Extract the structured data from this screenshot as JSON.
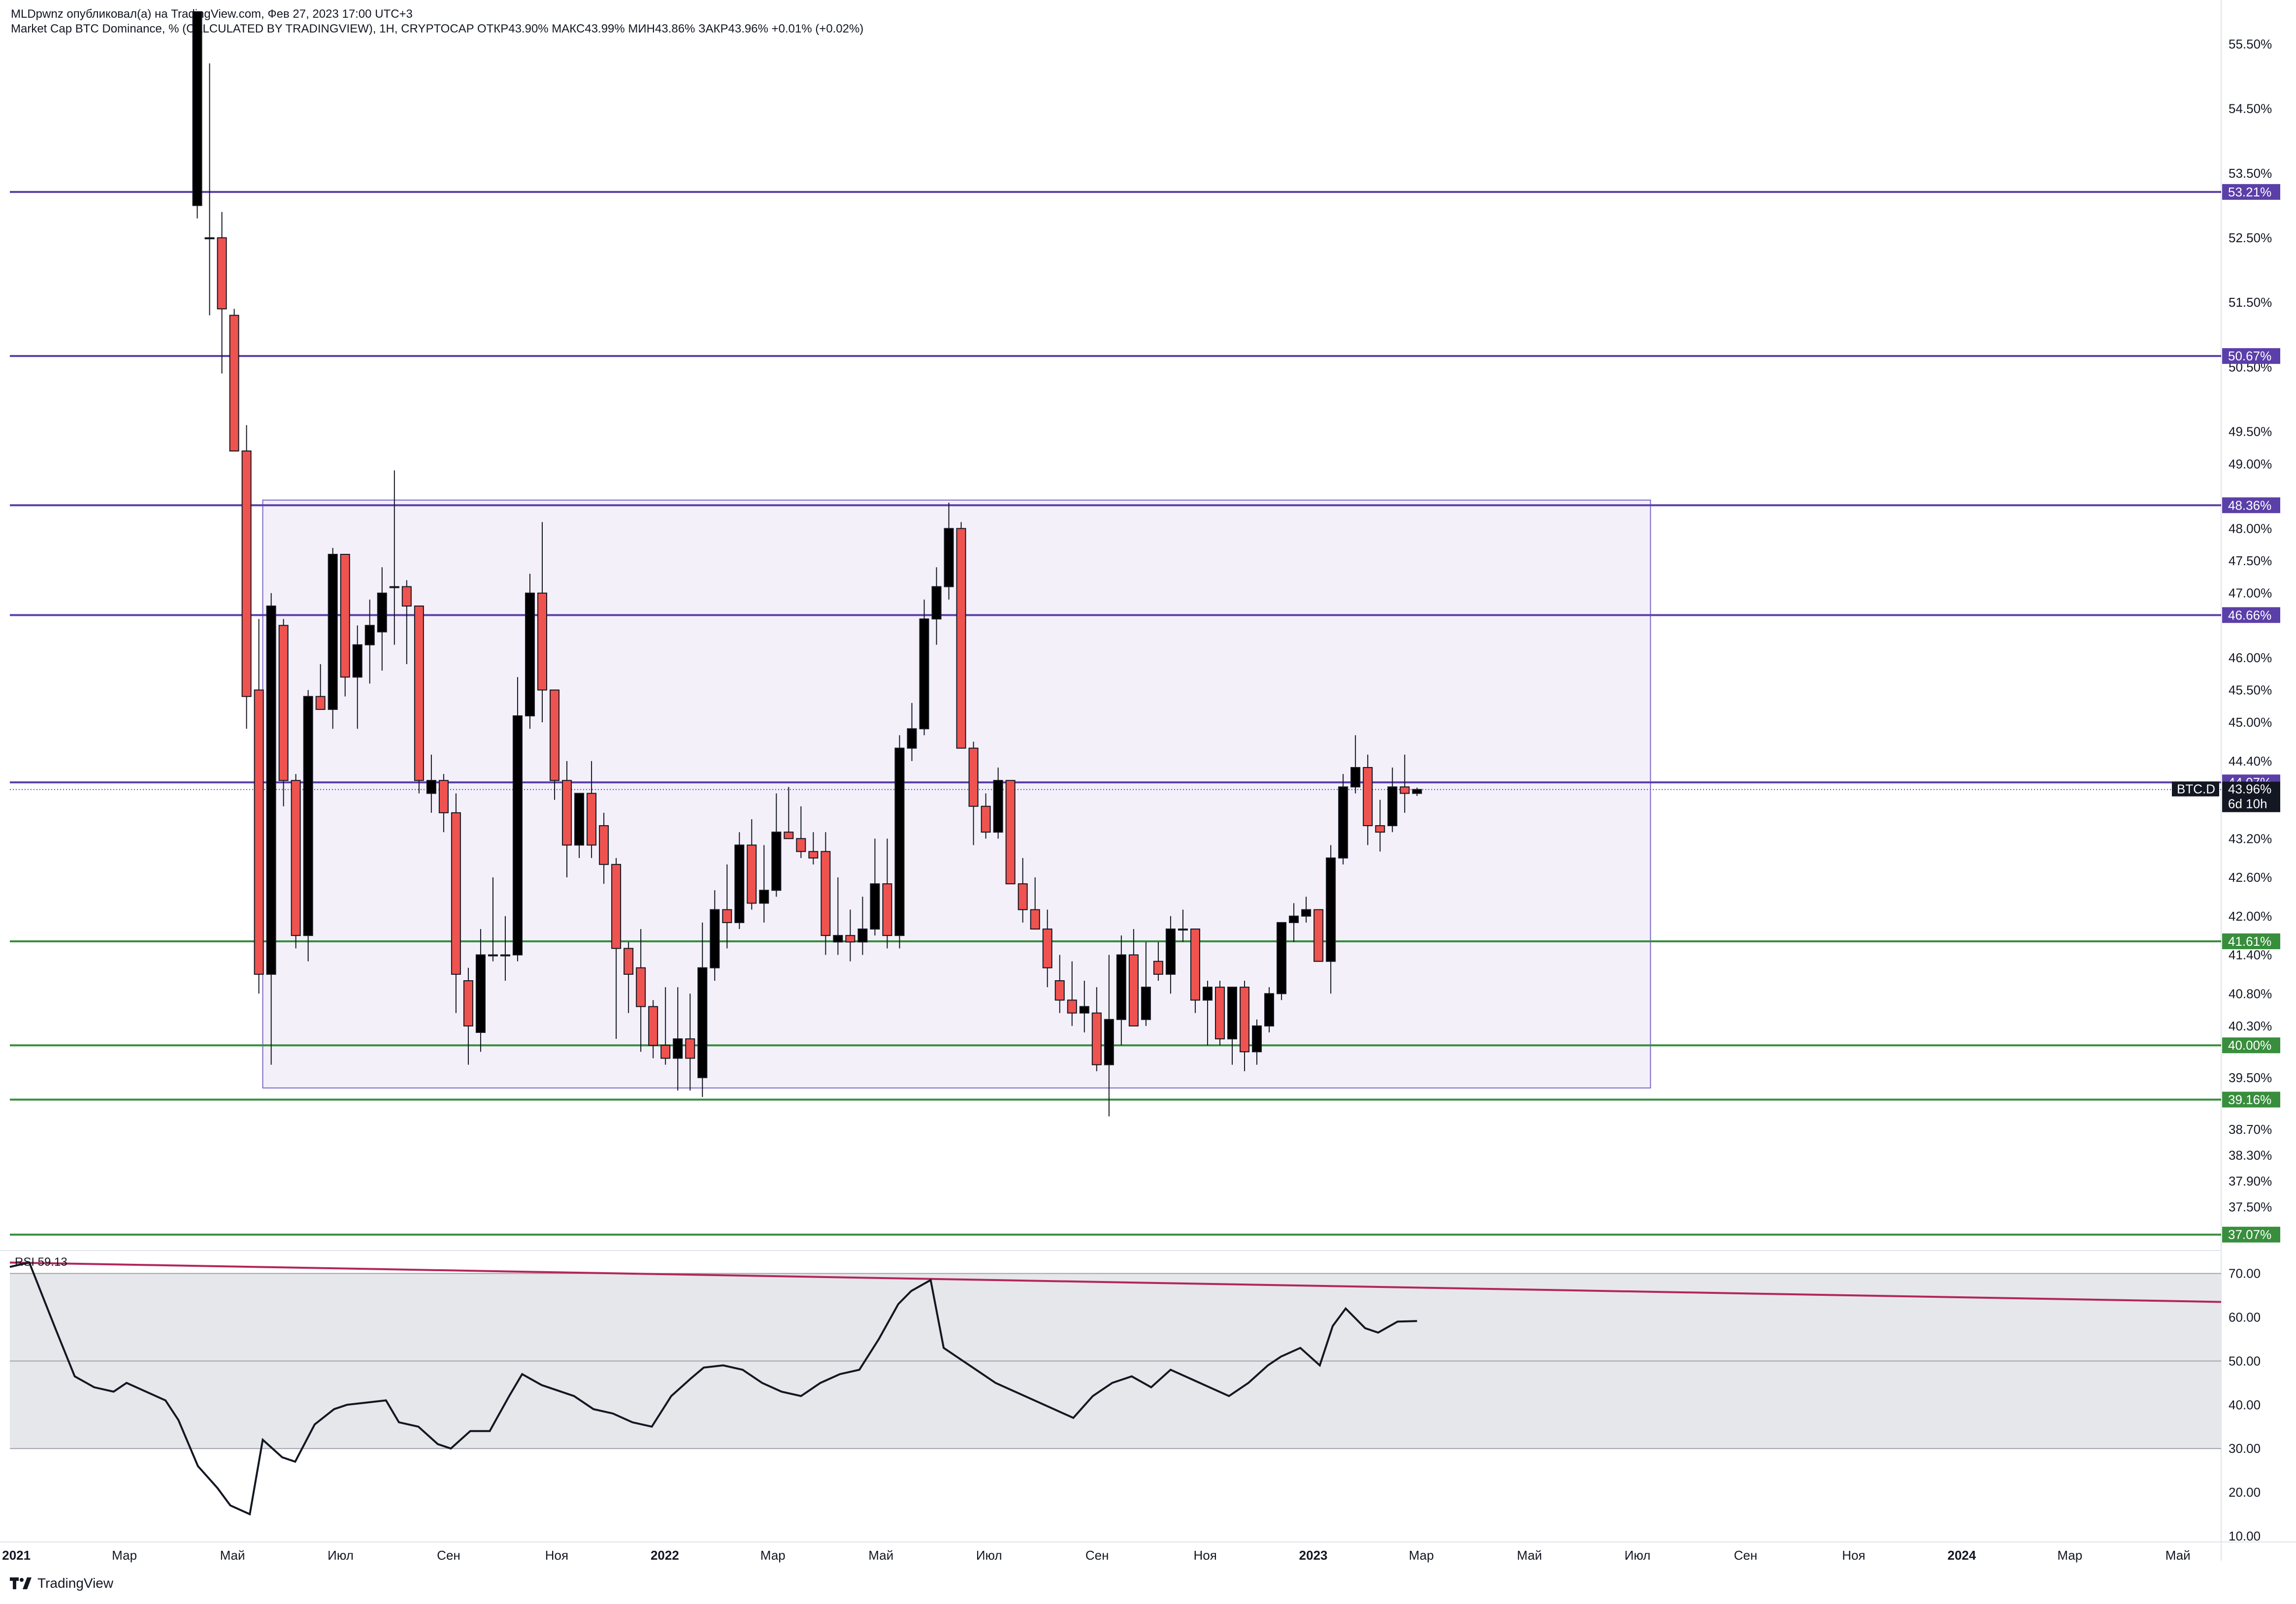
{
  "header": {
    "publisher_line": "MLDpwnz опубликовал(а) на TradingView.com, Фев 27, 2023 17:00 UTC+3",
    "symbol_line": "Market Cap BTC Dominance, % (CALCULATED BY TRADINGVIEW), 1H, CRYPTOCAP  ОТКР43.90%  МАКС43.99%  МИН43.86%  ЗАКР43.96%  +0.01% (+0.02%)"
  },
  "footer": {
    "logo_text": "TradingView"
  },
  "rsi_label": "RSI  59.13",
  "colors": {
    "bull": "#000000",
    "bear": "#ef5350",
    "purple": "#5b3fa8",
    "green": "#388e3c",
    "box_fill": "#f3f0fa",
    "box_border": "#7b68c8",
    "rsi_band": "#e6e7ea",
    "rsi_trend": "#b2275a"
  },
  "chart_data": [
    {
      "type": "candlestick",
      "title": "Market Cap BTC Dominance, % (CALCULATED BY TRADINGVIEW)",
      "y_axis_ticks": [
        "55.50%",
        "54.50%",
        "53.50%",
        "52.50%",
        "51.50%",
        "50.50%",
        "49.50%",
        "49.00%",
        "48.00%",
        "47.50%",
        "47.00%",
        "46.00%",
        "45.50%",
        "45.00%",
        "44.40%",
        "43.20%",
        "42.60%",
        "42.00%",
        "41.40%",
        "40.80%",
        "40.30%",
        "39.50%",
        "38.70%",
        "38.30%",
        "37.90%",
        "37.50%"
      ],
      "x_axis_ticks": [
        "2021",
        "Мар",
        "Май",
        "Июл",
        "Сен",
        "Ноя",
        "2022",
        "Мар",
        "Май",
        "Июл",
        "Сен",
        "Ноя",
        "2023",
        "Мар",
        "Май",
        "Июл",
        "Сен",
        "Ноя",
        "2024",
        "Мар",
        "Май"
      ],
      "ylim": [
        36.9,
        55.8
      ],
      "xlim": [
        2020.99,
        2024.4
      ],
      "candles": [
        {
          "t": 2021.279,
          "o": 53.0,
          "h": 56.0,
          "l": 52.8,
          "c": 56.0
        },
        {
          "t": 2021.298,
          "o": 52.5,
          "h": 55.2,
          "l": 51.3,
          "c": 52.5
        },
        {
          "t": 2021.317,
          "o": 52.5,
          "h": 52.9,
          "l": 50.4,
          "c": 51.4
        },
        {
          "t": 2021.336,
          "o": 51.3,
          "h": 51.4,
          "l": 49.2,
          "c": 49.2
        },
        {
          "t": 2021.355,
          "o": 49.2,
          "h": 49.6,
          "l": 44.9,
          "c": 45.4
        },
        {
          "t": 2021.374,
          "o": 45.5,
          "h": 46.6,
          "l": 40.8,
          "c": 41.1
        },
        {
          "t": 2021.393,
          "o": 41.1,
          "h": 47.0,
          "l": 39.7,
          "c": 46.8
        },
        {
          "t": 2021.412,
          "o": 46.5,
          "h": 46.6,
          "l": 43.7,
          "c": 44.1
        },
        {
          "t": 2021.431,
          "o": 44.1,
          "h": 44.2,
          "l": 41.5,
          "c": 41.7
        },
        {
          "t": 2021.45,
          "o": 41.7,
          "h": 45.5,
          "l": 41.3,
          "c": 45.4
        },
        {
          "t": 2021.469,
          "o": 45.4,
          "h": 45.9,
          "l": 45.2,
          "c": 45.2
        },
        {
          "t": 2021.488,
          "o": 45.2,
          "h": 47.7,
          "l": 44.9,
          "c": 47.6
        },
        {
          "t": 2021.507,
          "o": 47.6,
          "h": 47.6,
          "l": 45.4,
          "c": 45.7
        },
        {
          "t": 2021.526,
          "o": 45.7,
          "h": 46.5,
          "l": 44.9,
          "c": 46.2
        },
        {
          "t": 2021.545,
          "o": 46.2,
          "h": 46.9,
          "l": 45.6,
          "c": 46.5
        },
        {
          "t": 2021.564,
          "o": 46.4,
          "h": 47.4,
          "l": 45.8,
          "c": 47.0
        },
        {
          "t": 2021.583,
          "o": 47.1,
          "h": 48.9,
          "l": 46.2,
          "c": 47.1
        },
        {
          "t": 2021.602,
          "o": 47.1,
          "h": 47.2,
          "l": 45.9,
          "c": 46.8
        },
        {
          "t": 2021.621,
          "o": 46.8,
          "h": 46.8,
          "l": 43.9,
          "c": 44.1
        },
        {
          "t": 2021.64,
          "o": 43.9,
          "h": 44.5,
          "l": 43.6,
          "c": 44.1
        },
        {
          "t": 2021.659,
          "o": 44.1,
          "h": 44.2,
          "l": 43.3,
          "c": 43.6
        },
        {
          "t": 2021.678,
          "o": 43.6,
          "h": 43.9,
          "l": 40.5,
          "c": 41.1
        },
        {
          "t": 2021.697,
          "o": 41.0,
          "h": 41.2,
          "l": 39.7,
          "c": 40.3
        },
        {
          "t": 2021.716,
          "o": 40.2,
          "h": 41.8,
          "l": 39.9,
          "c": 41.4
        },
        {
          "t": 2021.735,
          "o": 41.4,
          "h": 42.6,
          "l": 41.3,
          "c": 41.4
        },
        {
          "t": 2021.754,
          "o": 41.4,
          "h": 42.0,
          "l": 41.0,
          "c": 41.4
        },
        {
          "t": 2021.773,
          "o": 41.4,
          "h": 45.7,
          "l": 41.3,
          "c": 45.1
        },
        {
          "t": 2021.792,
          "o": 45.1,
          "h": 47.3,
          "l": 44.9,
          "c": 47.0
        },
        {
          "t": 2021.811,
          "o": 47.0,
          "h": 48.1,
          "l": 45.0,
          "c": 45.5
        },
        {
          "t": 2021.83,
          "o": 45.5,
          "h": 45.5,
          "l": 43.8,
          "c": 44.1
        },
        {
          "t": 2021.849,
          "o": 44.1,
          "h": 44.4,
          "l": 42.6,
          "c": 43.1
        },
        {
          "t": 2021.868,
          "o": 43.1,
          "h": 43.9,
          "l": 42.9,
          "c": 43.9
        },
        {
          "t": 2021.887,
          "o": 43.9,
          "h": 44.4,
          "l": 42.9,
          "c": 43.1
        },
        {
          "t": 2021.906,
          "o": 43.4,
          "h": 43.6,
          "l": 42.5,
          "c": 42.8
        },
        {
          "t": 2021.925,
          "o": 42.8,
          "h": 42.9,
          "l": 40.1,
          "c": 41.5
        },
        {
          "t": 2021.944,
          "o": 41.5,
          "h": 41.6,
          "l": 40.5,
          "c": 41.1
        },
        {
          "t": 2021.963,
          "o": 41.2,
          "h": 41.8,
          "l": 39.9,
          "c": 40.6
        },
        {
          "t": 2021.982,
          "o": 40.6,
          "h": 40.7,
          "l": 39.8,
          "c": 40.0
        },
        {
          "t": 2022.001,
          "o": 40.0,
          "h": 40.9,
          "l": 39.7,
          "c": 39.8
        },
        {
          "t": 2022.02,
          "o": 39.8,
          "h": 40.9,
          "l": 39.3,
          "c": 40.1
        },
        {
          "t": 2022.039,
          "o": 40.1,
          "h": 40.8,
          "l": 39.3,
          "c": 39.8
        },
        {
          "t": 2022.058,
          "o": 39.5,
          "h": 41.9,
          "l": 39.2,
          "c": 41.2
        },
        {
          "t": 2022.077,
          "o": 41.2,
          "h": 42.4,
          "l": 41.0,
          "c": 42.1
        },
        {
          "t": 2022.096,
          "o": 42.1,
          "h": 42.8,
          "l": 41.5,
          "c": 41.9
        },
        {
          "t": 2022.115,
          "o": 41.9,
          "h": 43.3,
          "l": 41.8,
          "c": 43.1
        },
        {
          "t": 2022.134,
          "o": 43.1,
          "h": 43.5,
          "l": 42.1,
          "c": 42.2
        },
        {
          "t": 2022.153,
          "o": 42.2,
          "h": 43.1,
          "l": 41.9,
          "c": 42.4
        },
        {
          "t": 2022.172,
          "o": 42.4,
          "h": 43.9,
          "l": 42.3,
          "c": 43.3
        },
        {
          "t": 2022.191,
          "o": 43.3,
          "h": 44.0,
          "l": 43.2,
          "c": 43.2
        },
        {
          "t": 2022.21,
          "o": 43.2,
          "h": 43.7,
          "l": 42.9,
          "c": 43.0
        },
        {
          "t": 2022.229,
          "o": 43.0,
          "h": 43.3,
          "l": 42.8,
          "c": 42.9
        },
        {
          "t": 2022.248,
          "o": 43.0,
          "h": 43.3,
          "l": 41.4,
          "c": 41.7
        },
        {
          "t": 2022.267,
          "o": 41.6,
          "h": 42.6,
          "l": 41.4,
          "c": 41.7
        },
        {
          "t": 2022.286,
          "o": 41.7,
          "h": 42.1,
          "l": 41.3,
          "c": 41.6
        },
        {
          "t": 2022.305,
          "o": 41.6,
          "h": 42.3,
          "l": 41.4,
          "c": 41.8
        },
        {
          "t": 2022.324,
          "o": 41.8,
          "h": 43.2,
          "l": 41.7,
          "c": 42.5
        },
        {
          "t": 2022.343,
          "o": 42.5,
          "h": 43.2,
          "l": 41.5,
          "c": 41.7
        },
        {
          "t": 2022.362,
          "o": 41.7,
          "h": 44.8,
          "l": 41.5,
          "c": 44.6
        },
        {
          "t": 2022.381,
          "o": 44.6,
          "h": 45.3,
          "l": 44.4,
          "c": 44.9
        },
        {
          "t": 2022.4,
          "o": 44.9,
          "h": 46.9,
          "l": 44.8,
          "c": 46.6
        },
        {
          "t": 2022.419,
          "o": 46.6,
          "h": 47.4,
          "l": 46.2,
          "c": 47.1
        },
        {
          "t": 2022.438,
          "o": 47.1,
          "h": 48.4,
          "l": 46.9,
          "c": 48.0
        },
        {
          "t": 2022.457,
          "o": 48.0,
          "h": 48.1,
          "l": 44.6,
          "c": 44.6
        },
        {
          "t": 2022.476,
          "o": 44.6,
          "h": 44.7,
          "l": 43.1,
          "c": 43.7
        },
        {
          "t": 2022.495,
          "o": 43.7,
          "h": 43.9,
          "l": 43.2,
          "c": 43.3
        },
        {
          "t": 2022.514,
          "o": 43.3,
          "h": 44.3,
          "l": 43.2,
          "c": 44.1
        },
        {
          "t": 2022.533,
          "o": 44.1,
          "h": 44.1,
          "l": 42.5,
          "c": 42.5
        },
        {
          "t": 2022.552,
          "o": 42.5,
          "h": 42.9,
          "l": 41.9,
          "c": 42.1
        },
        {
          "t": 2022.571,
          "o": 42.1,
          "h": 42.6,
          "l": 41.8,
          "c": 41.8
        },
        {
          "t": 2022.59,
          "o": 41.8,
          "h": 42.1,
          "l": 40.9,
          "c": 41.2
        },
        {
          "t": 2022.609,
          "o": 41.0,
          "h": 41.4,
          "l": 40.5,
          "c": 40.7
        },
        {
          "t": 2022.628,
          "o": 40.7,
          "h": 41.3,
          "l": 40.3,
          "c": 40.5
        },
        {
          "t": 2022.647,
          "o": 40.5,
          "h": 41.0,
          "l": 40.2,
          "c": 40.6
        },
        {
          "t": 2022.666,
          "o": 40.5,
          "h": 40.9,
          "l": 39.6,
          "c": 39.7
        },
        {
          "t": 2022.685,
          "o": 39.7,
          "h": 41.4,
          "l": 38.9,
          "c": 40.4
        },
        {
          "t": 2022.704,
          "o": 40.4,
          "h": 41.7,
          "l": 40.0,
          "c": 41.4
        },
        {
          "t": 2022.723,
          "o": 41.4,
          "h": 41.8,
          "l": 40.6,
          "c": 40.3
        },
        {
          "t": 2022.742,
          "o": 40.4,
          "h": 41.6,
          "l": 40.3,
          "c": 40.9
        },
        {
          "t": 2022.761,
          "o": 41.3,
          "h": 41.6,
          "l": 41.0,
          "c": 41.1
        },
        {
          "t": 2022.78,
          "o": 41.1,
          "h": 42.0,
          "l": 40.8,
          "c": 41.8
        },
        {
          "t": 2022.799,
          "o": 41.8,
          "h": 42.1,
          "l": 41.6,
          "c": 41.8
        },
        {
          "t": 2022.818,
          "o": 41.8,
          "h": 41.8,
          "l": 40.5,
          "c": 40.7
        },
        {
          "t": 2022.837,
          "o": 40.7,
          "h": 41.0,
          "l": 40.0,
          "c": 40.9
        },
        {
          "t": 2022.856,
          "o": 40.9,
          "h": 41.0,
          "l": 40.0,
          "c": 40.1
        },
        {
          "t": 2022.875,
          "o": 40.1,
          "h": 40.9,
          "l": 39.7,
          "c": 40.9
        },
        {
          "t": 2022.894,
          "o": 40.9,
          "h": 41.0,
          "l": 39.6,
          "c": 39.9
        },
        {
          "t": 2022.913,
          "o": 39.9,
          "h": 40.4,
          "l": 39.7,
          "c": 40.3
        },
        {
          "t": 2022.932,
          "o": 40.3,
          "h": 40.9,
          "l": 40.2,
          "c": 40.8
        },
        {
          "t": 2022.951,
          "o": 40.8,
          "h": 41.9,
          "l": 40.7,
          "c": 41.9
        },
        {
          "t": 2022.97,
          "o": 41.9,
          "h": 42.2,
          "l": 41.6,
          "c": 42.0
        },
        {
          "t": 2022.989,
          "o": 42.0,
          "h": 42.3,
          "l": 41.9,
          "c": 42.1
        },
        {
          "t": 2023.008,
          "o": 42.1,
          "h": 42.1,
          "l": 41.4,
          "c": 41.3
        },
        {
          "t": 2023.027,
          "o": 41.3,
          "h": 43.1,
          "l": 40.8,
          "c": 42.9
        },
        {
          "t": 2023.046,
          "o": 42.9,
          "h": 44.2,
          "l": 42.8,
          "c": 44.0
        },
        {
          "t": 2023.065,
          "o": 44.0,
          "h": 44.8,
          "l": 43.9,
          "c": 44.3
        },
        {
          "t": 2023.084,
          "o": 44.3,
          "h": 44.5,
          "l": 43.1,
          "c": 43.4
        },
        {
          "t": 2023.103,
          "o": 43.4,
          "h": 43.8,
          "l": 43.0,
          "c": 43.3
        },
        {
          "t": 2023.122,
          "o": 43.4,
          "h": 44.3,
          "l": 43.3,
          "c": 44.0
        },
        {
          "t": 2023.141,
          "o": 44.0,
          "h": 44.5,
          "l": 43.6,
          "c": 43.9
        },
        {
          "t": 2023.16,
          "o": 43.9,
          "h": 43.99,
          "l": 43.86,
          "c": 43.96
        }
      ],
      "levels": [
        {
          "value": 53.21,
          "label": "53.21%",
          "color": "purple"
        },
        {
          "value": 50.67,
          "label": "50.67%",
          "color": "purple"
        },
        {
          "value": 48.36,
          "label": "48.36%",
          "color": "purple"
        },
        {
          "value": 46.66,
          "label": "46.66%",
          "color": "purple"
        },
        {
          "value": 44.07,
          "label": "44.07%",
          "color": "purple"
        },
        {
          "value": 41.61,
          "label": "41.61%",
          "color": "green"
        },
        {
          "value": 40.0,
          "label": "40.00%",
          "color": "green"
        },
        {
          "value": 39.16,
          "label": "39.16%",
          "color": "green"
        },
        {
          "value": 37.07,
          "label": "37.07%",
          "color": "green"
        }
      ],
      "range_box": {
        "t_start": 2021.38,
        "t_end": 2023.52,
        "top": 48.44,
        "bottom": 39.34
      },
      "last_price": {
        "symbol": "BTC.D",
        "value": "43.96%",
        "countdown": "6d 10h"
      }
    },
    {
      "type": "line",
      "name": "RSI",
      "value_label": "59.13",
      "y_axis_ticks": [
        "70.00",
        "60.00",
        "50.00",
        "40.00",
        "30.00",
        "20.00",
        "10.00"
      ],
      "ylim": [
        10,
        73
      ],
      "band": [
        30,
        70
      ],
      "midline": 50,
      "x": [
        2020.99,
        2021.02,
        2021.06,
        2021.09,
        2021.12,
        2021.15,
        2021.17,
        2021.2,
        2021.23,
        2021.25,
        2021.28,
        2021.31,
        2021.33,
        2021.36,
        2021.38,
        2021.41,
        2021.43,
        2021.46,
        2021.49,
        2021.51,
        2021.54,
        2021.57,
        2021.59,
        2021.62,
        2021.65,
        2021.67,
        2021.7,
        2021.73,
        2021.76,
        2021.78,
        2021.81,
        2021.84,
        2021.86,
        2021.89,
        2021.92,
        2021.95,
        2021.98,
        2022.01,
        2022.04,
        2022.06,
        2022.09,
        2022.12,
        2022.15,
        2022.18,
        2022.21,
        2022.24,
        2022.27,
        2022.3,
        2022.33,
        2022.36,
        2022.38,
        2022.41,
        2022.43,
        2022.45,
        2022.48,
        2022.51,
        2022.54,
        2022.57,
        2022.6,
        2022.63,
        2022.66,
        2022.69,
        2022.72,
        2022.75,
        2022.78,
        2022.81,
        2022.84,
        2022.87,
        2022.9,
        2022.93,
        2022.95,
        2022.98,
        2023.01,
        2023.03,
        2023.05,
        2023.08,
        2023.1,
        2023.13,
        2023.16
      ],
      "values": [
        71.5,
        72.5,
        57.5,
        46.5,
        44.0,
        43.0,
        45.0,
        43.0,
        41.0,
        36.5,
        26.0,
        21.0,
        17.0,
        15.0,
        32.0,
        28.0,
        27.0,
        35.5,
        39.0,
        40.0,
        40.5,
        41.0,
        36.0,
        35.0,
        31.0,
        30.0,
        34.0,
        34.0,
        42.0,
        47.0,
        44.5,
        43.0,
        42.0,
        39.0,
        38.0,
        36.0,
        35.0,
        42.0,
        46.0,
        48.5,
        49.0,
        48.0,
        45.0,
        43.0,
        42.0,
        45.0,
        47.0,
        48.0,
        55.0,
        63.0,
        66.0,
        68.5,
        53.0,
        51.0,
        48.0,
        45.0,
        43.0,
        41.0,
        39.0,
        37.0,
        42.0,
        45.0,
        46.5,
        44.0,
        48.0,
        46.0,
        44.0,
        42.0,
        45.0,
        49.0,
        51.0,
        53.0,
        49.0,
        58.0,
        62.0,
        57.5,
        56.5,
        59.0,
        59.13
      ],
      "trendline": {
        "x_start": 2020.99,
        "y_start": 72.5,
        "x_end": 2024.4,
        "y_end": 63.5
      }
    }
  ]
}
